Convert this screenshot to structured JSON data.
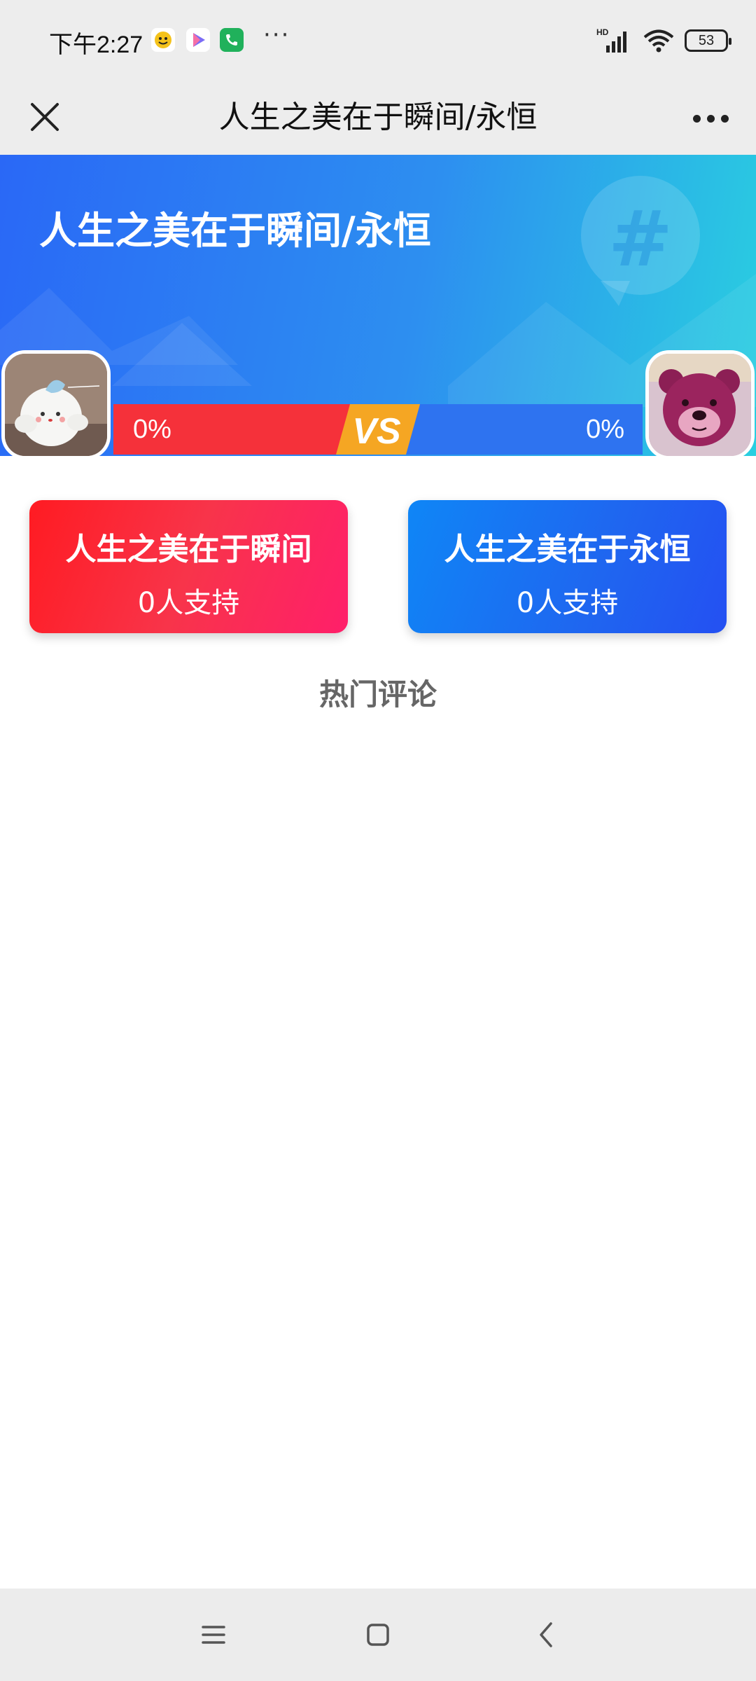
{
  "status_bar": {
    "time": "下午2:27",
    "app_icons": [
      "sticker-app-icon",
      "video-app-icon",
      "phone-app-icon"
    ],
    "more": "···",
    "network": "HD",
    "battery": "53"
  },
  "navbar": {
    "title": "人生之美在于瞬间/永恒"
  },
  "banner": {
    "title": "人生之美在于瞬间/永恒",
    "left_percent": "0%",
    "right_percent": "0%",
    "vs_label": "VS"
  },
  "options": [
    {
      "label": "人生之美在于瞬间",
      "support": "0人支持",
      "color": "#f5313a"
    },
    {
      "label": "人生之美在于永恒",
      "support": "0人支持",
      "color": "#2e73f0"
    }
  ],
  "comments": {
    "title": "热门评论"
  },
  "colors": {
    "accent_red": "#f5313a",
    "accent_blue": "#2e73f0",
    "bar_bg": "#ededed"
  }
}
